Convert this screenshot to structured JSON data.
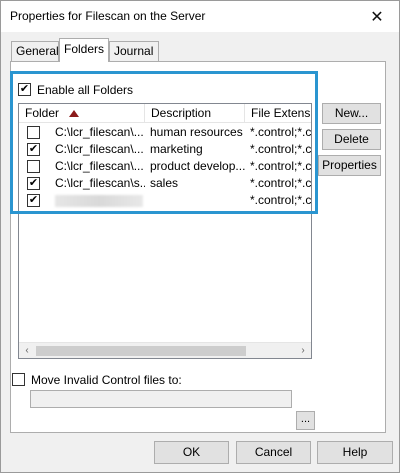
{
  "window": {
    "title": "Properties for Filescan on the Server",
    "close_glyph": "✕"
  },
  "tabs": [
    {
      "label": "General"
    },
    {
      "label": "Folders"
    },
    {
      "label": "Journal"
    }
  ],
  "active_tab": "Folders",
  "enable_all": {
    "label": "Enable all Folders",
    "checked": true,
    "mark": "✔"
  },
  "list": {
    "columns": [
      "Folder",
      "Description",
      "File Extension"
    ],
    "sorted_column": "Folder",
    "rows": [
      {
        "checked": false,
        "mark": "",
        "folder": "C:\\lcr_filescan\\...",
        "description": "human resources",
        "extensions": "*.control;*.co"
      },
      {
        "checked": true,
        "mark": "✔",
        "folder": "C:\\lcr_filescan\\...",
        "description": "marketing",
        "extensions": "*.control;*.co"
      },
      {
        "checked": false,
        "mark": "",
        "folder": "C:\\lcr_filescan\\...",
        "description": "product develop...",
        "extensions": "*.control;*.co"
      },
      {
        "checked": true,
        "mark": "✔",
        "folder": "C:\\lcr_filescan\\s...",
        "description": "sales",
        "extensions": "*.control;*.co"
      },
      {
        "checked": true,
        "mark": "✔",
        "folder": "",
        "description": "",
        "extensions": "*.control;*.co",
        "folder_redacted": true
      }
    ],
    "scroll_left": "‹",
    "scroll_right": "›"
  },
  "side_buttons": {
    "new": "New...",
    "delete": "Delete",
    "properties": "Properties"
  },
  "move_invalid": {
    "label": "Move Invalid Control files to:",
    "checked": false,
    "path_value": "",
    "browse_label": "..."
  },
  "dialog_buttons": {
    "ok": "OK",
    "cancel": "Cancel",
    "help": "Help"
  },
  "colors": {
    "highlight": "#2a95d0",
    "sort_arrow": "#8b1a1a"
  }
}
